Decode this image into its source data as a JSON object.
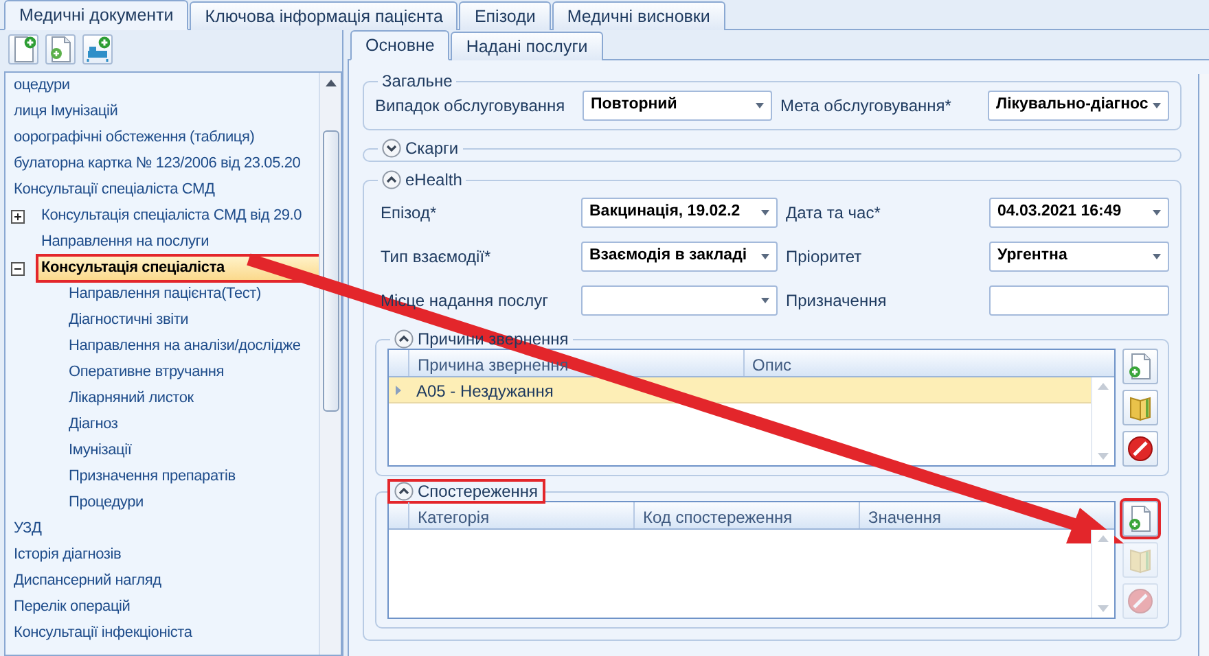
{
  "top_tabs": [
    {
      "label": "Медичні документи",
      "selected": true
    },
    {
      "label": "Ключова інформація пацієнта",
      "selected": false
    },
    {
      "label": "Епізоди",
      "selected": false
    },
    {
      "label": "Медичні висновки",
      "selected": false
    }
  ],
  "tree": [
    {
      "label": "оцедури",
      "selected": false
    },
    {
      "label": "лиця Імунізацій",
      "selected": false
    },
    {
      "label": "оорографічні обстеження (таблиця)",
      "selected": false
    },
    {
      "label": "булаторна картка № 123/2006 від 23.05.20",
      "selected": false
    },
    {
      "label": "Консультації спеціаліста СМД",
      "selected": false,
      "children": [
        {
          "label": "Консультація спеціаліста СМД від 29.0",
          "selected": false,
          "expanded": false
        },
        {
          "label": "Направлення на послуги",
          "selected": false
        },
        {
          "label": "Консультація спеціаліста",
          "selected": true,
          "expanded": true,
          "callout": true,
          "children": [
            {
              "label": "Направлення пацієнта(Тест)",
              "selected": false
            },
            {
              "label": "Діагностичні звіти",
              "selected": false
            },
            {
              "label": "Направлення на аналізи/дослідже",
              "selected": false
            },
            {
              "label": "Оперативне втручання",
              "selected": false
            },
            {
              "label": "Лікарняний листок",
              "selected": false
            },
            {
              "label": "Діагноз",
              "selected": false
            },
            {
              "label": "Імунізації",
              "selected": false
            },
            {
              "label": "Призначення препаратів",
              "selected": false
            },
            {
              "label": "Процедури",
              "selected": false
            }
          ]
        }
      ]
    },
    {
      "label": "УЗД",
      "selected": false
    },
    {
      "label": "Історія діагнозів",
      "selected": false
    },
    {
      "label": "Диспансерний нагляд",
      "selected": false
    },
    {
      "label": "Перелік операцій",
      "selected": false
    },
    {
      "label": "Консультації інфекціоніста",
      "selected": false
    }
  ],
  "detail_tabs": [
    {
      "label": "Основне",
      "selected": true
    },
    {
      "label": "Надані послуги",
      "selected": false
    }
  ],
  "general": {
    "title": "Загальне",
    "fields": [
      {
        "label": "Випадок обслуговування",
        "kind": "combo",
        "value": "Повторний"
      },
      {
        "label": "Мета обслуговування*",
        "kind": "combo",
        "value": "Лікувально-діагнос"
      }
    ]
  },
  "sections": [
    {
      "title": "Скарги",
      "expanded": false
    },
    {
      "title": "eHealth",
      "expanded": true,
      "fields": [
        {
          "label": "Епізод*",
          "kind": "combo",
          "value": "Вакцинація, 19.02.2"
        },
        {
          "label": "Дата та час*",
          "kind": "combo",
          "value": "04.03.2021 16:49"
        },
        {
          "label": "Тип взаємодії*",
          "kind": "combo",
          "value": "Взаємодія в закладі"
        },
        {
          "label": "Пріоритет",
          "kind": "combo",
          "value": "Ургентна"
        },
        {
          "label": "Місце надання послуг",
          "kind": "combo"
        },
        {
          "label": "Призначення",
          "kind": "text"
        }
      ],
      "groups": [
        {
          "title": "Причини звернення",
          "expanded": true,
          "columns": [
            "Причина звернення",
            "Опис"
          ],
          "rows": [
            {
              "cells": [
                "A05 - Нездужання"
              ],
              "selected": true
            }
          ],
          "buttons": [
            {
              "kind": "add",
              "disabled": false
            },
            {
              "kind": "open",
              "disabled": false
            },
            {
              "kind": "delete",
              "disabled": false
            }
          ]
        },
        {
          "title": "Спостереження",
          "expanded": true,
          "callout": true,
          "columns": [
            "Категорія",
            "Код спостереження",
            "Значення"
          ],
          "buttons": [
            {
              "kind": "add",
              "disabled": false,
              "callout": true
            },
            {
              "kind": "open",
              "disabled": true
            },
            {
              "kind": "delete",
              "disabled": true
            }
          ]
        }
      ]
    }
  ]
}
